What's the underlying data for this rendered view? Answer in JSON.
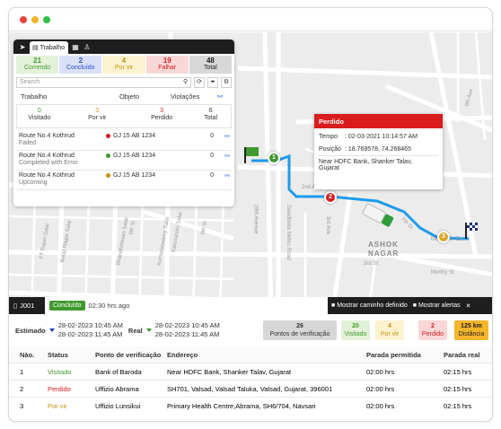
{
  "panel": {
    "tab_label": "Trabalho",
    "counts": [
      {
        "label": "Correndo",
        "value": "21",
        "bg": "#e3f1d9",
        "color": "#3f9a2e"
      },
      {
        "label": "Concluído",
        "value": "2",
        "bg": "#d9e0f8",
        "color": "#2a4ec7"
      },
      {
        "label": "Por vir",
        "value": "4",
        "bg": "#fbf3cf",
        "color": "#c9930f"
      },
      {
        "label": "Falhar",
        "value": "19",
        "bg": "#f9d7d7",
        "color": "#d91c1c"
      },
      {
        "label": "Total",
        "value": "48",
        "bg": "#d7d7d7",
        "color": "#222222"
      }
    ],
    "search_placeholder": "Search",
    "headers": {
      "trabalho": "Trabalho",
      "objeto": "Objeto",
      "violacoes": "Violações"
    },
    "summary": [
      {
        "value": "0",
        "label": "Visitado",
        "color": "#3f9a2e"
      },
      {
        "value": "3",
        "label": "Por vir",
        "color": "#c9930f"
      },
      {
        "value": "3",
        "label": "Perdido",
        "color": "#d91c1c"
      },
      {
        "value": "6",
        "label": "Total",
        "color": "#333333"
      }
    ],
    "routes": [
      {
        "name": "Route No.4 Kothrud",
        "status": "Failed",
        "object": "GJ 15 AB 1234",
        "dot": "#d91c1c",
        "violations": "0"
      },
      {
        "name": "Route No.4 Kothrud",
        "status": "Completed with Error",
        "object": "GJ 15 AB 1234",
        "dot": "#3f9a2e",
        "violations": "0"
      },
      {
        "name": "Route No.4 Kothrud",
        "status": "Upcoming",
        "object": "GJ 15 AB 1234",
        "dot": "#c9930f",
        "violations": "0"
      }
    ]
  },
  "popup": {
    "title": "Perdido",
    "tempo_label": "Tempo",
    "tempo_value": ": 02-03-2021 10:14:57 AM",
    "posicao_label": "Posição",
    "posicao_value": ": 18.769578, 74.268465",
    "address_line1": "Near HDFC Bank, Shanker Talav,",
    "address_line2": "Gujarat"
  },
  "map": {
    "markers": [
      "1",
      "2",
      "3"
    ],
    "area_label_1": "ASHOK",
    "area_label_2": "NAGAR",
    "streets": [
      "2nd Ave",
      "3rd Ave",
      "6th Ave",
      "9th Ave",
      "Swadhinta Nehru Road",
      "16th Avenue",
      "19th Avenue",
      "18th Avenue",
      "3rd Avenue",
      "14th Avenue",
      "8th St",
      "7th St",
      "Murthy St Ext",
      "Murthy St",
      "Hiranagar Salai",
      "Balaji Nagar Salai",
      "PT Rajan Salai",
      "Bharathidasan Salai",
      "Karunanithi Salai",
      "Kumaraswamy Salai",
      "9th St",
      "8th St",
      "10th Avenue",
      "11th Avenue",
      "12th Avenue",
      "3rd St"
    ]
  },
  "map_footer": {
    "job_id": "J001",
    "status_badge": "Concluído",
    "duration": "02:30 hrs ago",
    "show_path": "Mostrar caminho definido",
    "show_alerts": "Mostrar alertas"
  },
  "estimate": {
    "estimated_label": "Estimado",
    "estimated_start": "28-02-2023 10:45 AM",
    "estimated_end": "28-02-2023 11:45 AM",
    "real_label": "Real",
    "real_start": "28-02-2023 10:45 AM",
    "real_end": "28-02-2023 11:45 AM",
    "stats": [
      {
        "value": "26",
        "label": "Pontos de verificação",
        "bg": "#d6d6d6",
        "color": "#333333"
      },
      {
        "value": "20",
        "label": "Visitado",
        "bg": "#e3f1d9",
        "color": "#3f9a2e"
      },
      {
        "value": "4",
        "label": "Por vir",
        "bg": "#fbf3cf",
        "color": "#c9930f"
      },
      {
        "value": "2",
        "label": "Perdido",
        "bg": "#f9d7d7",
        "color": "#d91c1c"
      },
      {
        "value": "125 km",
        "label": "Distância",
        "bg": "#f7b52b",
        "color": "#222222"
      }
    ]
  },
  "table": {
    "headers": [
      "Nào.",
      "Status",
      "Ponto de verificação",
      "Endereço",
      "Parada permitida",
      "Parada real"
    ],
    "rows": [
      {
        "no": "1",
        "status": "Visitado",
        "status_color": "#3f9a2e",
        "checkpoint": "Bank of Baroda",
        "address": "Near HDFC Bank, Shanker Talav, Gujarat",
        "allowed": "02:00 hrs",
        "actual": "02:15 hrs"
      },
      {
        "no": "2",
        "status": "Perdido",
        "status_color": "#d91c1c",
        "checkpoint": "Uffizio Abrama",
        "address": "SH701, Valsad, Valsad Taluka, Valsad, Gujarat, 396001",
        "allowed": "02:00 hrs",
        "actual": "02:15 hrs"
      },
      {
        "no": "3",
        "status": "Por vir",
        "status_color": "#c9930f",
        "checkpoint": "Uffizio Lunsikui",
        "address": "Primary Health Centre,Abrama, SH6/704, Navsari",
        "allowed": "02:00 hrs",
        "actual": "02:15 hrs"
      }
    ]
  },
  "colors": {
    "accent_dark": "#1e1e1e",
    "route_blue": "#1e9be9",
    "alert_red": "#d91c1c"
  }
}
